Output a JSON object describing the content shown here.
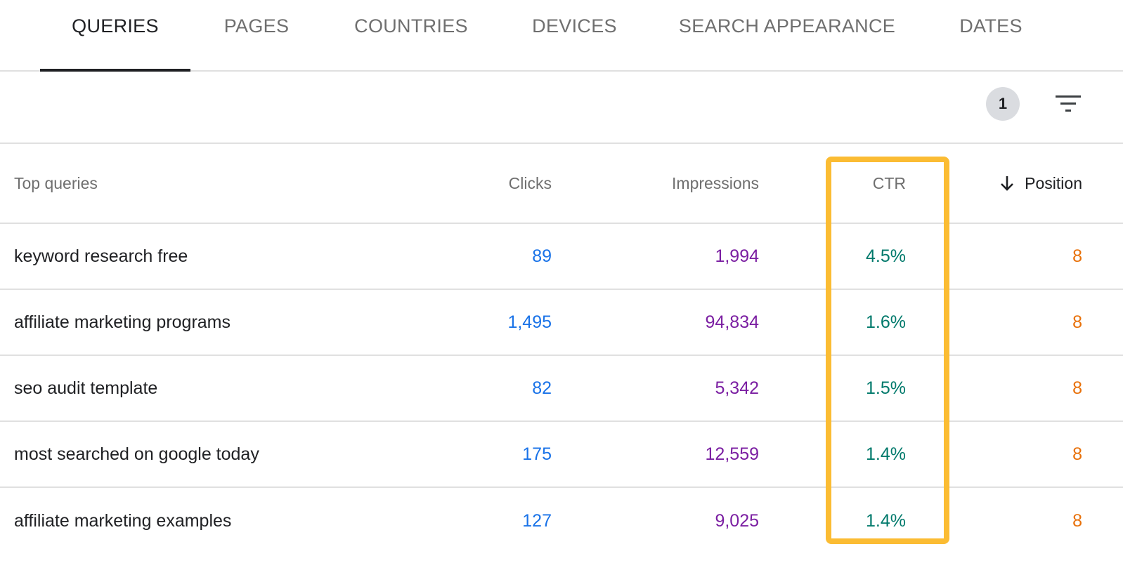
{
  "tabs": [
    {
      "label": "QUERIES",
      "active": true
    },
    {
      "label": "PAGES",
      "active": false
    },
    {
      "label": "COUNTRIES",
      "active": false
    },
    {
      "label": "DEVICES",
      "active": false
    },
    {
      "label": "SEARCH APPEARANCE",
      "active": false
    },
    {
      "label": "DATES",
      "active": false
    }
  ],
  "toolbar": {
    "filter_count": "1",
    "filter_icon": "filter-list-icon"
  },
  "table": {
    "headers": {
      "query": "Top queries",
      "clicks": "Clicks",
      "impressions": "Impressions",
      "ctr": "CTR",
      "position": "Position",
      "sort_icon": "arrow-down-icon"
    },
    "rows": [
      {
        "query": "keyword research free",
        "clicks": "89",
        "impressions": "1,994",
        "ctr": "4.5%",
        "position": "8"
      },
      {
        "query": "affiliate marketing programs",
        "clicks": "1,495",
        "impressions": "94,834",
        "ctr": "1.6%",
        "position": "8"
      },
      {
        "query": "seo audit template",
        "clicks": "82",
        "impressions": "5,342",
        "ctr": "1.5%",
        "position": "8"
      },
      {
        "query": "most searched on google today",
        "clicks": "175",
        "impressions": "12,559",
        "ctr": "1.4%",
        "position": "8"
      },
      {
        "query": "affiliate marketing examples",
        "clicks": "127",
        "impressions": "9,025",
        "ctr": "1.4%",
        "position": "8"
      }
    ]
  },
  "colors": {
    "clicks": "#1a73e8",
    "impressions": "#7b1fa2",
    "ctr": "#00796b",
    "position": "#e8710a",
    "highlight": "#fbbc33"
  }
}
